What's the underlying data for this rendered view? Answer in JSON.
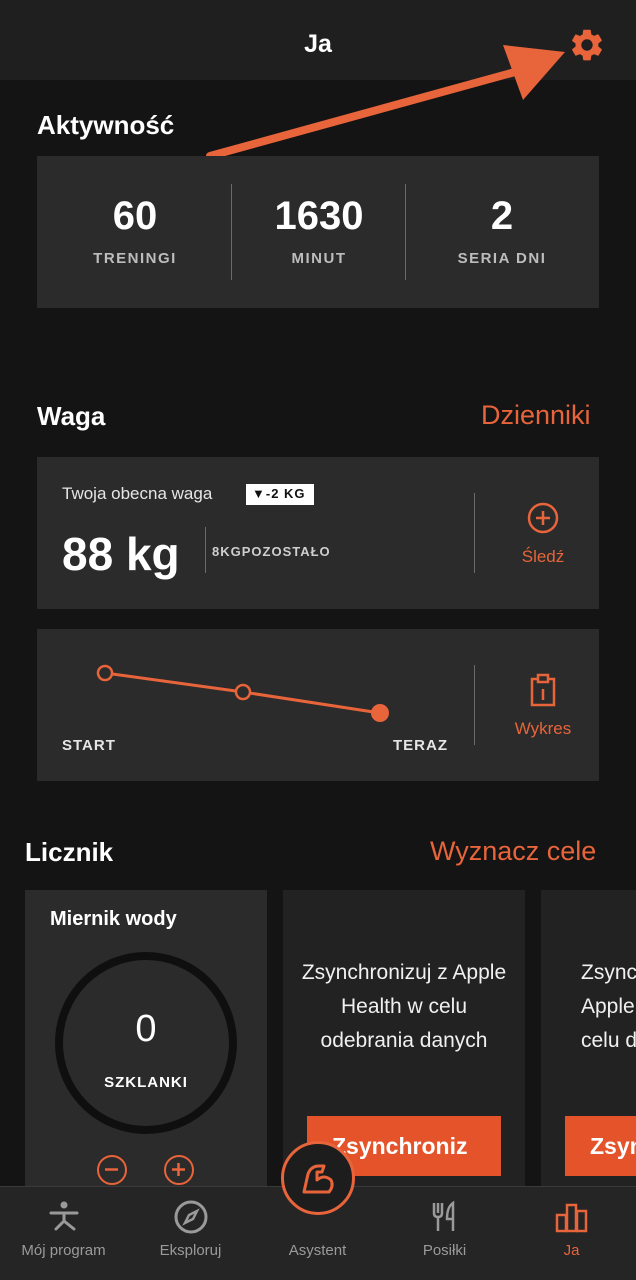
{
  "header": {
    "title": "Ja"
  },
  "activity": {
    "title": "Aktywność",
    "stats": [
      {
        "value": "60",
        "label": "TRENINGI"
      },
      {
        "value": "1630",
        "label": "MINUT"
      },
      {
        "value": "2",
        "label": "SERIA DNI"
      }
    ]
  },
  "weight": {
    "title": "Waga",
    "logs_link": "Dzienniki",
    "current_label": "Twoja obecna waga",
    "delta_badge": "▼-2 KG",
    "current_value": "88 kg",
    "remaining": "8KGPOZOSTAŁO",
    "track_label": "Śledź",
    "chart": {
      "start_label": "START",
      "now_label": "TERAZ",
      "action_label": "Wykres"
    }
  },
  "counter": {
    "title": "Licznik",
    "goals_link": "Wyznacz cele",
    "water": {
      "title": "Miernik wody",
      "value": "0",
      "unit": "SZKLANKI"
    },
    "sync_cards": [
      {
        "text": "Zsynchronizuj z Apple Health w celu odebrania danych",
        "button": "Zsynchroniz"
      },
      {
        "text": "Zsync Apple celu d",
        "button": "Zsyn"
      }
    ]
  },
  "nav": {
    "items": [
      {
        "label": "Mój program",
        "icon": "yoga-icon"
      },
      {
        "label": "Eksploruj",
        "icon": "compass-icon"
      },
      {
        "label": "Asystent",
        "icon": "flexed-arm-icon"
      },
      {
        "label": "Posiłki",
        "icon": "fork-knife-icon"
      },
      {
        "label": "Ja",
        "icon": "bar-chart-icon"
      }
    ],
    "active": "Ja"
  },
  "colors": {
    "accent": "#e8643a",
    "background": "#141414",
    "card": "#2b2b2b"
  },
  "annotation": {
    "arrow": "orange arrow pointing to settings"
  }
}
